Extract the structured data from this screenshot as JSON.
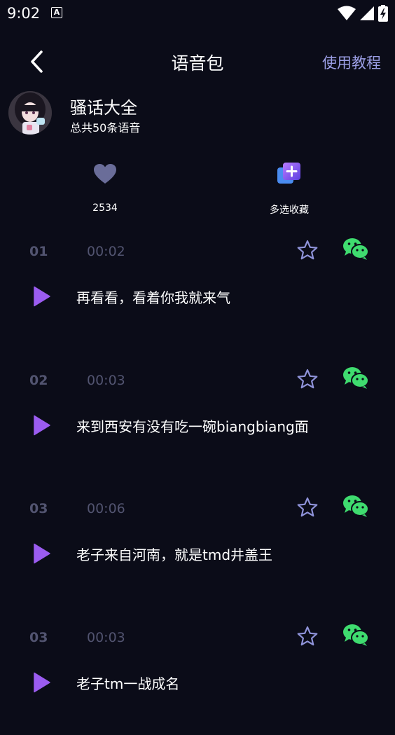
{
  "status_bar": {
    "time": "9:02",
    "notification_letter": "A"
  },
  "header": {
    "title": "语音包",
    "tutorial_label": "使用教程"
  },
  "profile": {
    "name": "骚话大全",
    "count_text": "总共50条语音"
  },
  "actions": {
    "like_count": "2534",
    "multi_collect_label": "多选收藏"
  },
  "colors": {
    "background": "#0b0c18",
    "accent": "#9c9fe6",
    "play": "#9b5cf0",
    "wechat": "#3fdc6f",
    "muted": "#525470"
  },
  "voices": [
    {
      "index": "01",
      "duration": "00:02",
      "text": "再看看，看着你我就来气"
    },
    {
      "index": "02",
      "duration": "00:03",
      "text": "来到西安有没有吃一碗biangbiang面"
    },
    {
      "index": "03",
      "duration": "00:06",
      "text": "老子来自河南，就是tmd井盖王"
    },
    {
      "index": "03",
      "duration": "00:03",
      "text": "老子tm一战成名"
    }
  ]
}
